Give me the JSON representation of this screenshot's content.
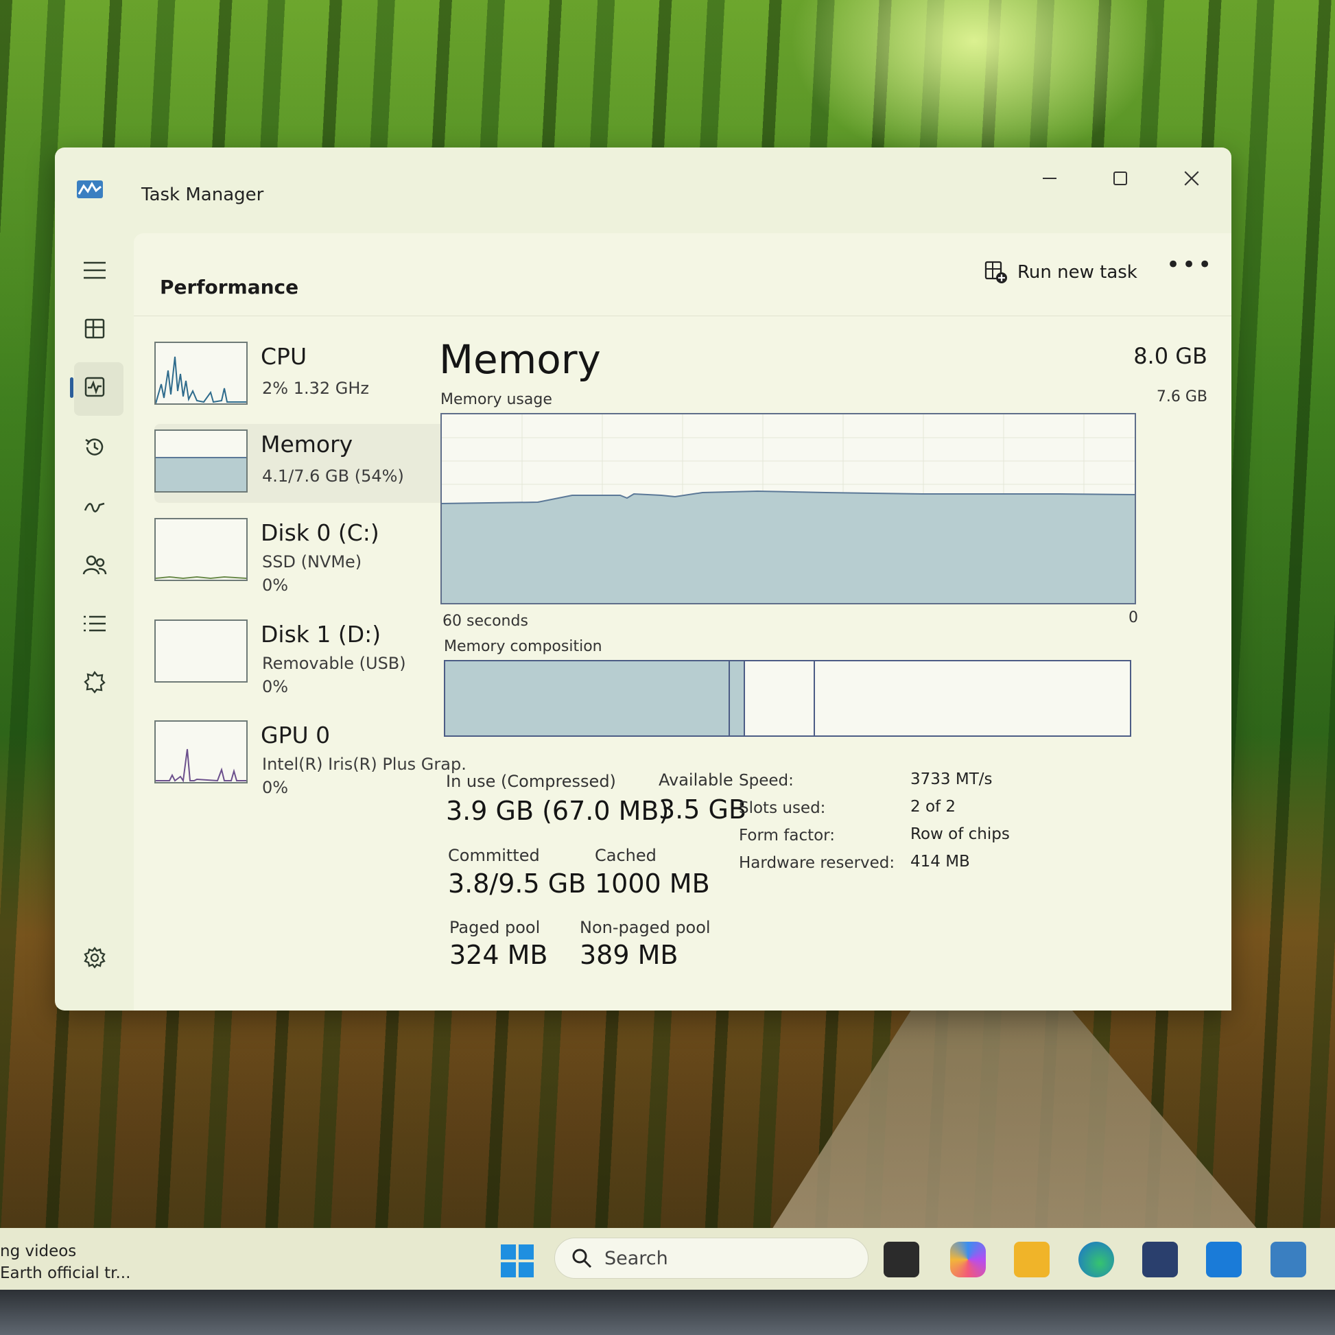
{
  "window": {
    "title": "Task Manager"
  },
  "header": {
    "title": "Performance",
    "run_new_task": "Run new task",
    "more": "•••"
  },
  "devices": [
    {
      "name": "CPU",
      "sub1": "2%  1.32 GHz",
      "sub2": ""
    },
    {
      "name": "Memory",
      "sub1": "4.1/7.6 GB (54%)",
      "sub2": ""
    },
    {
      "name": "Disk 0 (C:)",
      "sub1": "SSD (NVMe)",
      "sub2": "0%"
    },
    {
      "name": "Disk 1 (D:)",
      "sub1": "Removable (USB)",
      "sub2": "0%"
    },
    {
      "name": "GPU 0",
      "sub1": "Intel(R) Iris(R) Plus Grap.",
      "sub2": "0%"
    }
  ],
  "memory": {
    "title": "Memory",
    "total": "8.0 GB",
    "usage_label": "Memory usage",
    "usage_max": "7.6 GB",
    "time_left": "60 seconds",
    "time_right": "0",
    "composition_label": "Memory composition",
    "in_use_fraction": 0.54,
    "stats": {
      "in_use_label": "In use (Compressed)",
      "in_use_value": "3.9 GB (67.0 MB)",
      "available_label": "Available",
      "available_value": "3.5 GB",
      "committed_label": "Committed",
      "committed_value": "3.8/9.5 GB",
      "cached_label": "Cached",
      "cached_value": "1000 MB",
      "paged_label": "Paged pool",
      "paged_value": "324 MB",
      "nonpaged_label": "Non-paged pool",
      "nonpaged_value": "389 MB"
    },
    "hardware": [
      {
        "label": "Speed:",
        "value": "3733 MT/s"
      },
      {
        "label": "Slots used:",
        "value": "2 of 2"
      },
      {
        "label": "Form factor:",
        "value": "Row of chips"
      },
      {
        "label": "Hardware reserved:",
        "value": "414 MB"
      }
    ]
  },
  "taskbar": {
    "news_line1": "ng videos",
    "news_line2": "Earth official tr...",
    "search_placeholder": "Search"
  },
  "colors": {
    "memory_fill": "#b7cdd0",
    "memory_line": "#5b7897",
    "border": "#4c5c85"
  }
}
